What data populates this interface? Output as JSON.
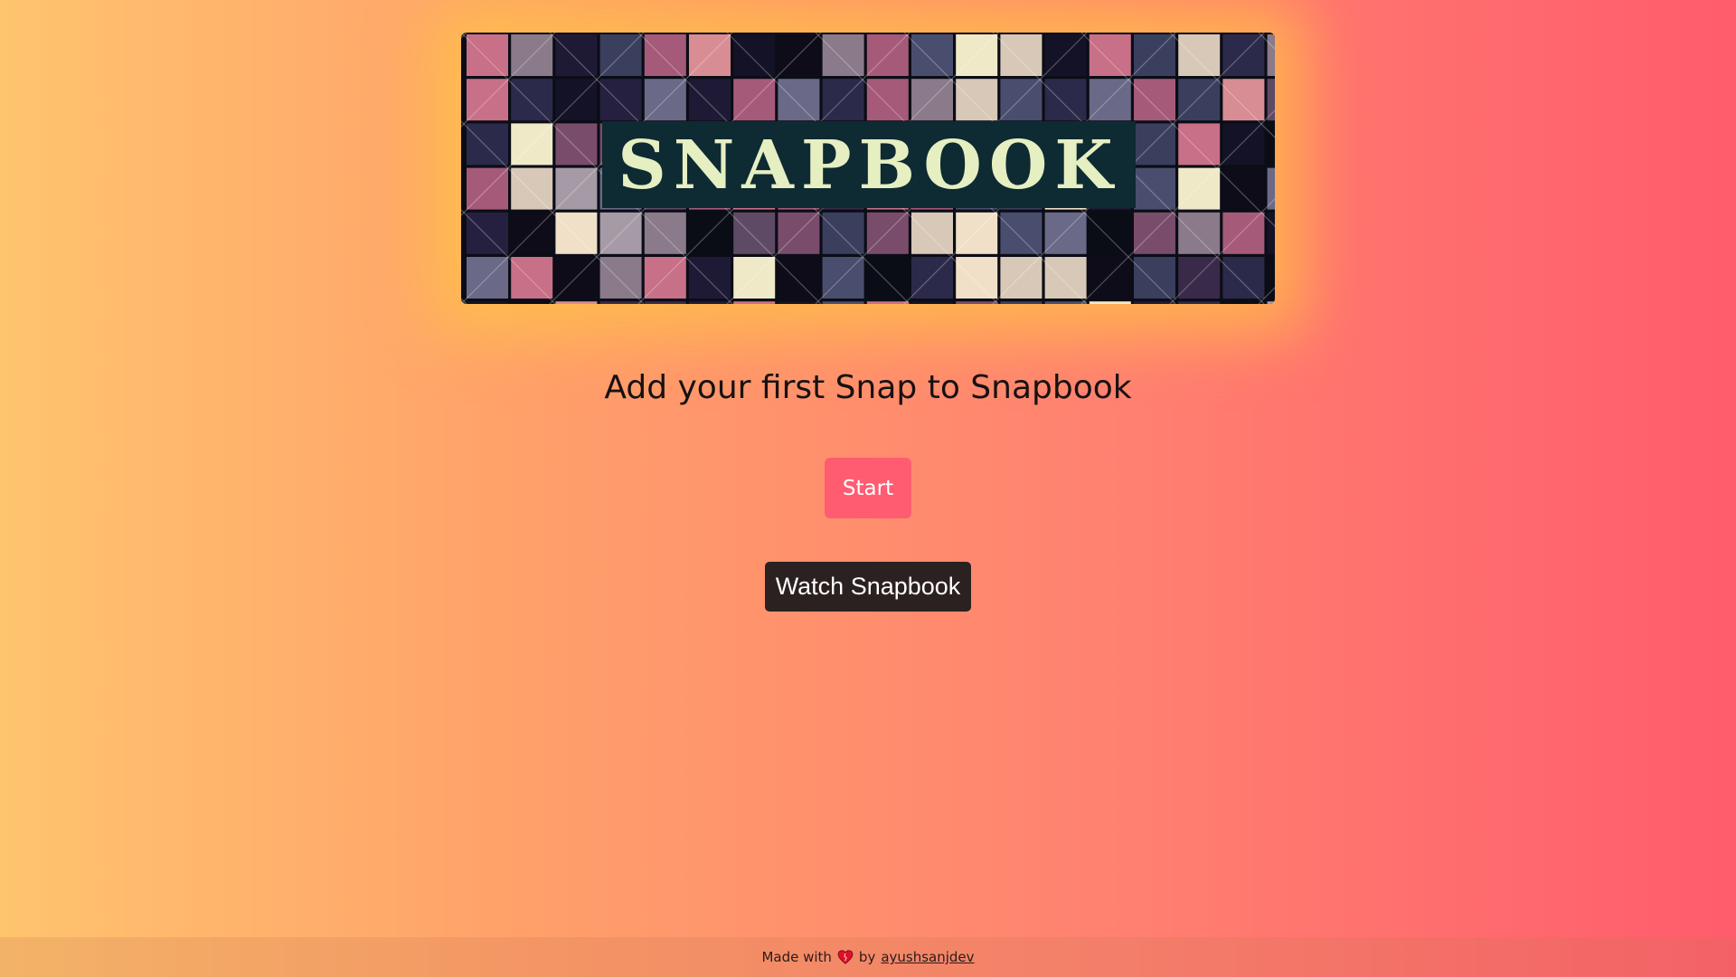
{
  "banner": {
    "logo_text": "SNAPBOOK"
  },
  "main": {
    "heading": "Add your first Snap to Snapbook",
    "start_label": "Start",
    "watch_label": "Watch Snapbook"
  },
  "footer": {
    "made_with": "Made with",
    "by": "by",
    "author": "ayushsanjdev",
    "heart_icon": "heart-icon"
  },
  "colors": {
    "background_left": "#ffc46e",
    "background_right": "#ff5c6c",
    "start_button": "#ff5c72",
    "watch_button": "#2b2120",
    "logo_box": "#0e2a33",
    "logo_text": "#e6efc2"
  }
}
